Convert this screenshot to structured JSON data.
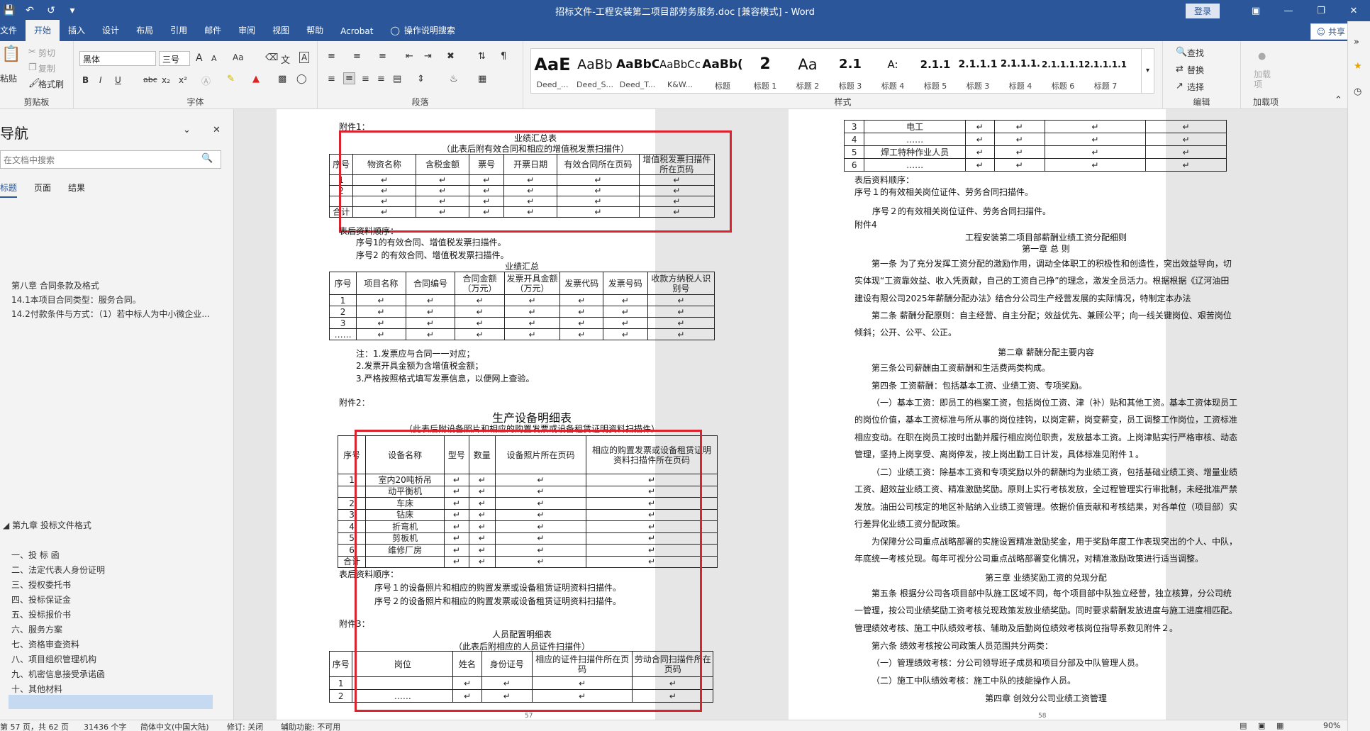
{
  "window": {
    "title": "招标文件-工程安装第二项目部劳务服务.doc [兼容模式] - Word",
    "login": "登录"
  },
  "tabs": {
    "file": "文件",
    "home": "开始",
    "insert": "插入",
    "design": "设计",
    "layout": "布局",
    "references": "引用",
    "mailings": "邮件",
    "review": "审阅",
    "view": "视图",
    "help": "帮助",
    "acrobat": "Acrobat",
    "tell_me": "操作说明搜索",
    "share": "共享"
  },
  "ribbon": {
    "clipboard": {
      "paste": "粘贴",
      "cut": "剪切",
      "copy": "复制",
      "format_painter": "格式刷",
      "label": "剪贴板"
    },
    "font": {
      "name": "黑体",
      "size": "三号",
      "label": "字体",
      "b": "B",
      "i": "I",
      "u": "U",
      "strike": "abc",
      "sub": "x₂",
      "sup": "x²",
      "grow": "A",
      "shrink": "A",
      "aa": "Aa",
      "case": "A"
    },
    "paragraph": {
      "label": "段落"
    },
    "styles": {
      "label": "样式",
      "items": [
        {
          "preview": "AaE",
          "name": "Deed_..."
        },
        {
          "preview": "AaBb",
          "name": "Deed_S..."
        },
        {
          "preview": "AaBbC",
          "name": "Deed_T..."
        },
        {
          "preview": "AaBbCc",
          "name": "K&W..."
        },
        {
          "preview": "AaBb(",
          "name": "标题"
        },
        {
          "preview": "2",
          "name": "标题 1"
        },
        {
          "preview": "Aa",
          "name": "标题 2"
        },
        {
          "preview": "2.1",
          "name": "标题 3"
        },
        {
          "preview": "A:",
          "name": "标题 4"
        },
        {
          "preview": "2.1.1",
          "name": "标题 5"
        },
        {
          "preview": "2.1.1.1",
          "name": "标题 3"
        },
        {
          "preview": "2.1.1.1.",
          "name": "标题 4"
        },
        {
          "preview": "2.1.1.1.1",
          "name": "标题 6"
        },
        {
          "preview": "2.1.1.1.1.",
          "name": "标题 7"
        }
      ]
    },
    "editing": {
      "find": "查找",
      "replace": "替换",
      "select": "选择",
      "label": "编辑"
    },
    "addins": {
      "load": "加载项",
      "label": "加载项"
    }
  },
  "nav": {
    "title": "导航",
    "search_placeholder": "在文档中搜索",
    "tabs": [
      "标题",
      "页面",
      "结果"
    ],
    "chapter8": "第八章 合同条款及格式",
    "items8": [
      "14.1本项目合同类型：服务合同。",
      "14.2付款条件与方式：（1）若中标人为中小微企业..."
    ],
    "chapter9": "第九章 投标文件格式",
    "items9": [
      "一、投 标 函",
      "二、法定代表人身份证明",
      "三、授权委托书",
      "四、投标保证金",
      "五、投标报价书",
      "六、服务方案",
      "七、资格审查资料",
      "八、项目组织管理机构",
      "九、机密信息接受承诺函",
      "十、其他材料"
    ]
  },
  "page1": {
    "fujian1": "附件1：",
    "t1_title": "业绩汇总表",
    "t1_sub": "（此表后附有效合同和相应的增值税发票扫描件）",
    "t1_headers": [
      "序号",
      "物资名称",
      "含税金额",
      "票号",
      "开票日期",
      "有效合同所在页码",
      "增值税发票扫描件所在页码"
    ],
    "t1_rows": [
      "1",
      "2",
      "",
      "合计"
    ],
    "order_title": "表后资料顺序：",
    "order1": "序号1的有效合同、增值税发票扫描件。",
    "order2": "序号2 的有效合同、增值税发票扫描件。",
    "t2_title": "业绩汇总",
    "t2_headers": [
      "序号",
      "项目名称",
      "合同编号",
      "合同金额（万元）",
      "发票开具金额（万元）",
      "发票代码",
      "发票号码",
      "收款方纳税人识别号"
    ],
    "t2_rows": [
      "1",
      "2",
      "3",
      "……"
    ],
    "note1": "注：1.发票应与合同一一对应；",
    "note2": "2.发票开具金额为含增值税金额；",
    "note3": "3.严格按照格式填写发票信息，以便网上查验。",
    "fujian2": "附件2：",
    "t3_title": "生产设备明细表",
    "t3_sub": "（此表后附设备照片和相应的购置发票或设备租赁证明资料扫描件）",
    "t3_headers": [
      "序号",
      "设备名称",
      "型号",
      "数量",
      "设备照片所在页码",
      "相应的购置发票或设备租赁证明资料扫描件所在页码"
    ],
    "t3_rows": [
      {
        "no": "1",
        "name": "室内20吨桥吊"
      },
      {
        "no": "",
        "name": "动平衡机"
      },
      {
        "no": "2",
        "name": "车床"
      },
      {
        "no": "3",
        "name": "钻床"
      },
      {
        "no": "4",
        "name": "折弯机"
      },
      {
        "no": "5",
        "name": "剪板机"
      },
      {
        "no": "6",
        "name": "维修厂房"
      },
      {
        "no": "合计",
        "name": ""
      }
    ],
    "order3_title": "表后资料顺序：",
    "order3_1": "序号１的设备照片和相应的购置发票或设备租赁证明资料扫描件。",
    "order3_2": "序号２的设备照片和相应的购置发票或设备租赁证明资料扫描件。",
    "fujian3": "附件3：",
    "t4_title": "人员配置明细表",
    "t4_sub": "（此表后附相应的人员证件扫描件）",
    "t4_headers": [
      "序号",
      "岗位",
      "姓名",
      "身份证号",
      "相应的证件扫描件所在页码",
      "劳动合同扫描件所在页码"
    ],
    "t4_rows": [
      {
        "no": "1",
        "post": ""
      },
      {
        "no": "2",
        "post": "……"
      }
    ],
    "page_num": "57"
  },
  "page2": {
    "t_rows": [
      {
        "no": "3",
        "post": "电工"
      },
      {
        "no": "4",
        "post": "……"
      },
      {
        "no": "5",
        "post": "焊工特种作业人员"
      },
      {
        "no": "6",
        "post": "……"
      }
    ],
    "order_title": "表后资料顺序：",
    "order1": "序号１的有效相关岗位证件、劳务合同扫描件。",
    "order2": "序号２的有效相关岗位证件、劳务合同扫描件。",
    "fujian4": "附件4",
    "doc_title": "工程安装第二项目部薪酬业绩工资分配细则",
    "ch1": "第一章 总 则",
    "p1": "第一条 为了充分发挥工资分配的激励作用，调动全体职工的积极性和创造性，突出效益导向，切实体现“工资靠效益、收入凭贡献，自己的工资自己挣”的理念，激发全员活力。根据根据《辽河油田建设有限公司2025年薪酬分配办法》结合分公司生产经营发展的实际情况，特制定本办法",
    "p2": "第二条 薪酬分配原则：自主经营、自主分配；效益优先、兼顾公平；向一线关键岗位、艰苦岗位倾斜；公开、公平、公正。",
    "ch2": "第二章 薪酬分配主要内容",
    "p3": "第三条公司薪酬由工资薪酬和生活费两类构成。",
    "p4": "第四条 工资薪酬：包括基本工资、业绩工资、专项奖励。",
    "p5": "（一）基本工资：即员工的档案工资，包括岗位工资、津（补）贴和其他工资。基本工资体现员工的岗位价值，基本工资标准与所从事的岗位挂钩，以岗定薪，岗变薪变，员工调整工作岗位，工资标准相应变动。在职在岗员工按时出勤并履行相应岗位职责，发放基本工资。上岗津贴实行严格审核、动态管理，坚持上岗享受、离岗停发，按上岗出勤工日计发，具体标准见附件１。",
    "p6": "（二）业绩工资：除基本工资和专项奖励以外的薪酬均为业绩工资，包括基础业绩工资、增量业绩工资、超效益业绩工资、精准激励奖励。原则上实行考核发放，全过程管理实行审批制，未经批准严禁发放。油田公司核定的地区补贴纳入业绩工资管理。依据价值贡献和考核结果，对各单位（项目部）实行差异化业绩工资分配政策。",
    "p7": "为保障分公司重点战略部署的实施设置精准激励奖金，用于奖励年度工作表现突出的个人、中队，年底统一考核兑现。每年可视分公司重点战略部署变化情况，对精准激励政策进行适当调整。",
    "ch3": "第三章 业绩奖励工资的兑现分配",
    "p8": "第五条 根据分公司各项目部中队施工区域不同，每个项目部中队独立经营，独立核算，分公司统一管理，按公司业绩奖励工资考核兑现政策发放业绩奖励。同时要求薪酬发放进度与施工进度相匹配。管理绩效考核、施工中队绩效考核、辅助及后勤岗位绩效考核岗位指导系数见附件２。",
    "p9": "第六条 绩效考核按公司政策人员范围共分两类：",
    "p10": "（一）管理绩效考核：分公司领导班子成员和项目分部及中队管理人员。",
    "p11": "（二）施工中队绩效考核：施工中队的技能操作人员。",
    "ch4": "第四章 创效分公司业绩工资管理",
    "page_num": "58"
  },
  "status": {
    "page": "第 57 页，共 62 页",
    "words": "31436 个字",
    "lang": "简体中文(中国大陆)",
    "track": "修订: 关闭",
    "access": "辅助功能: 不可用",
    "zoom": "90%"
  }
}
